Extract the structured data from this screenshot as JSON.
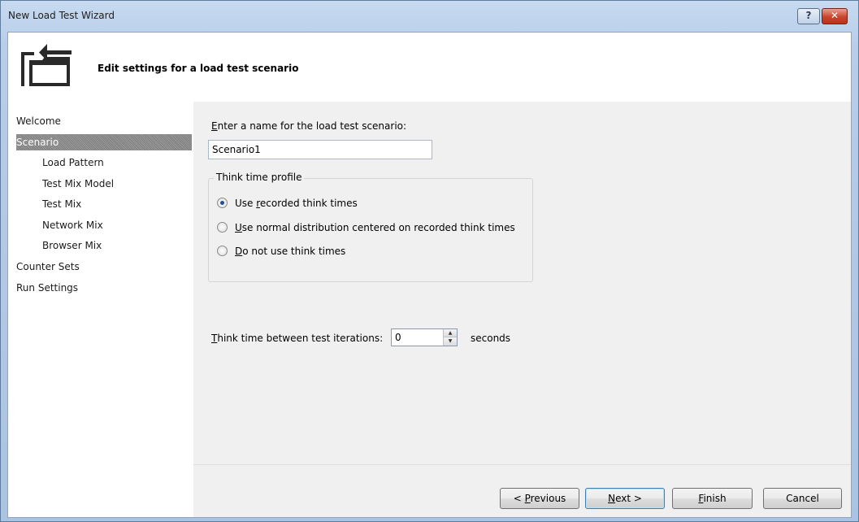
{
  "window": {
    "title": "New Load Test Wizard",
    "help_glyph": "?",
    "close_glyph": "✕"
  },
  "header": {
    "title": "Edit settings for a load test scenario",
    "icon": "wizard-folder-icon"
  },
  "nav": {
    "items": [
      {
        "label": "Welcome",
        "level": 0,
        "selected": false
      },
      {
        "label": "Scenario",
        "level": 0,
        "selected": true
      },
      {
        "label": "Load Pattern",
        "level": 1,
        "selected": false
      },
      {
        "label": "Test Mix Model",
        "level": 1,
        "selected": false
      },
      {
        "label": "Test Mix",
        "level": 1,
        "selected": false
      },
      {
        "label": "Network Mix",
        "level": 1,
        "selected": false
      },
      {
        "label": "Browser Mix",
        "level": 1,
        "selected": false
      },
      {
        "label": "Counter Sets",
        "level": 0,
        "selected": false
      },
      {
        "label": "Run Settings",
        "level": 0,
        "selected": false
      }
    ]
  },
  "form": {
    "name_label_hot": "E",
    "name_label_rest": "nter a name for the load test scenario:",
    "name_value": "Scenario1",
    "think_group_title": "Think time profile",
    "radios": [
      {
        "pre": "Use ",
        "hot": "r",
        "post": "ecorded think times",
        "checked": true
      },
      {
        "pre": "",
        "hot": "U",
        "post": "se normal distribution centered on recorded think times",
        "checked": false
      },
      {
        "pre": "",
        "hot": "D",
        "post": "o not use think times",
        "checked": false
      }
    ],
    "iter_label_hot": "T",
    "iter_label_rest": "hink time between test iterations:",
    "iter_value": "0",
    "iter_unit": "seconds"
  },
  "buttons": {
    "previous_pre": "< ",
    "previous_hot": "P",
    "previous_post": "revious",
    "next_hot": "N",
    "next_post": "ext >",
    "finish_hot": "F",
    "finish_post": "inish",
    "cancel": "Cancel"
  }
}
